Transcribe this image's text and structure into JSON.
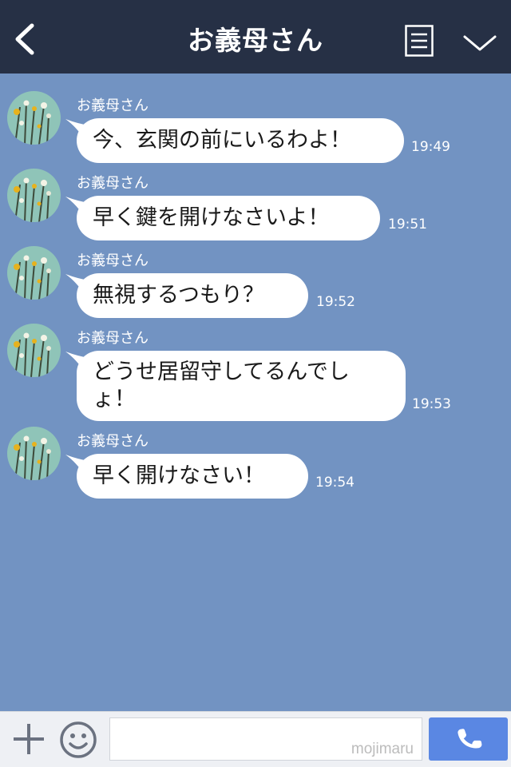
{
  "header": {
    "back_icon": "chevron-left-icon",
    "title": "お義母さん",
    "menu_icon": "menu-lines-icon",
    "dropdown_icon": "chevron-down-icon"
  },
  "messages": [
    {
      "sender": "お義母さん",
      "text": "今、玄関の前にいるわよ！",
      "time": "19:49"
    },
    {
      "sender": "お義母さん",
      "text": "早く鍵を開けなさいよ！",
      "time": "19:51"
    },
    {
      "sender": "お義母さん",
      "text": "無視するつもり？",
      "time": "19:52"
    },
    {
      "sender": "お義母さん",
      "text_line1": "どうせ居留守してるんでし",
      "text_line2": "ょ！",
      "time": "19:53"
    },
    {
      "sender": "お義母さん",
      "text": "早く開けなさい！",
      "time": "19:54"
    }
  ],
  "footer": {
    "plus_icon": "plus-icon",
    "emoji_icon": "smiley-icon",
    "input_value": "",
    "watermark": "mojimaru",
    "call_icon": "phone-icon"
  },
  "colors": {
    "header_bg": "#263045",
    "chat_bg": "#7293c2",
    "bubble_bg": "#ffffff",
    "call_button": "#5a87e3"
  }
}
